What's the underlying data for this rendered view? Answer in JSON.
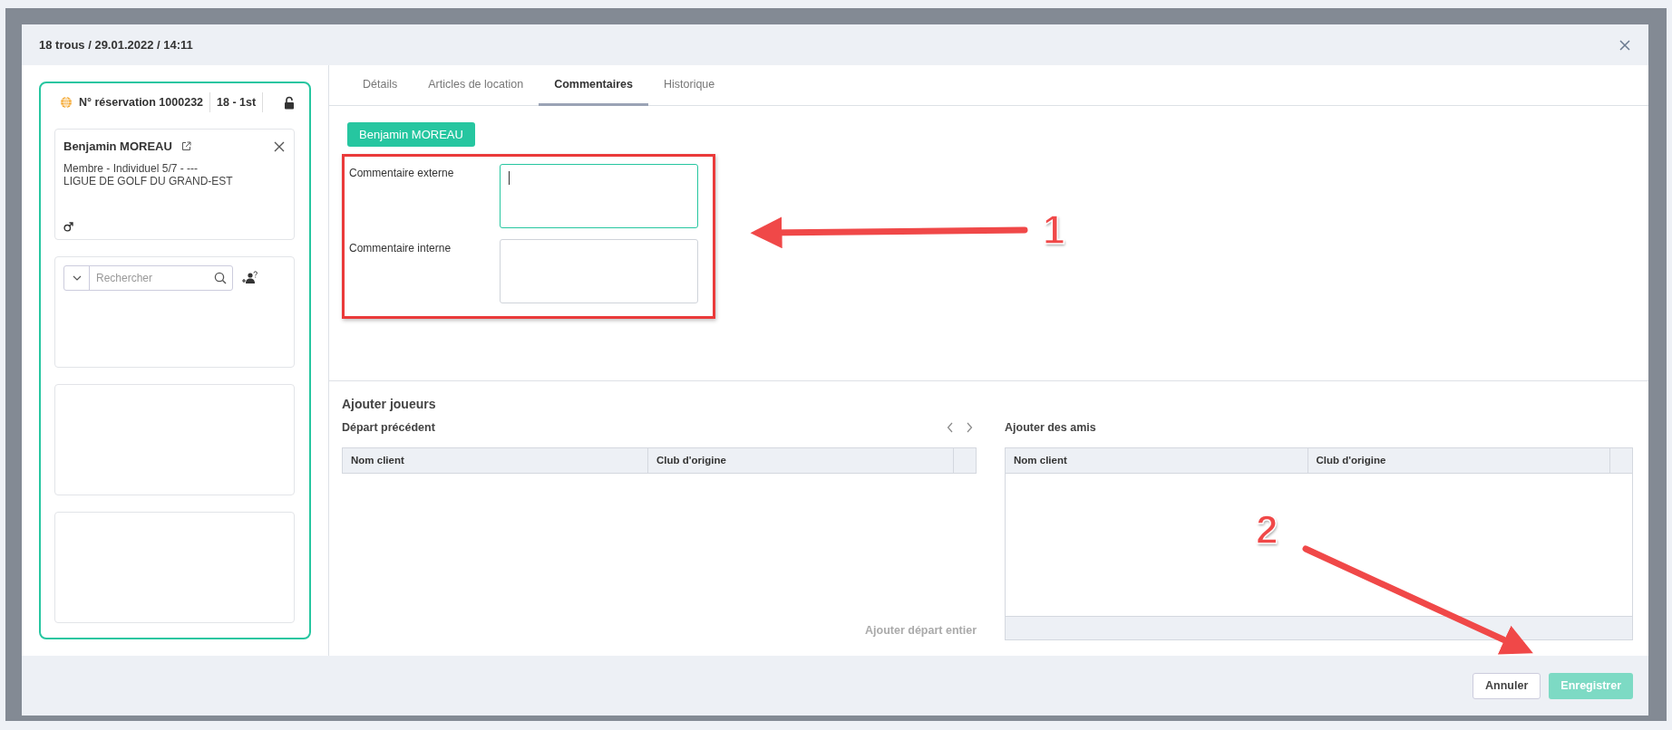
{
  "dialog": {
    "title": "18 trous / 29.01.2022 / 14:11"
  },
  "booking": {
    "reservation": "N° réservation 1000232",
    "tee": "18 - 1st",
    "locked": false
  },
  "player": {
    "name": "Benjamin MOREAU",
    "line_1": "Membre - Individuel 5/7 - ---",
    "line_2": "LIGUE DE GOLF DU GRAND-EST"
  },
  "search": {
    "placeholder": "Rechercher"
  },
  "tabs": [
    {
      "label": "Détails",
      "selected": false
    },
    {
      "label": "Articles de location",
      "selected": false
    },
    {
      "label": "Commentaires",
      "selected": true
    },
    {
      "label": "Historique",
      "selected": false
    }
  ],
  "player_button": "Benjamin MOREAU",
  "comments": [
    {
      "label": "Commentaire externe",
      "focused": true
    },
    {
      "label": "Commentaire interne",
      "focused": false
    }
  ],
  "add_players": {
    "title": "Ajouter joueurs",
    "previous": {
      "title": "Départ précédent",
      "columns": [
        "Nom client",
        "Club d'origine"
      ],
      "action": "Ajouter départ entier"
    },
    "friends": {
      "title": "Ajouter des amis",
      "columns": [
        "Nom client",
        "Club d'origine"
      ]
    }
  },
  "buttons": [
    {
      "label": "Annuler",
      "kind": "secondary",
      "disabled": false
    },
    {
      "label": "Enregistrer",
      "kind": "primary",
      "disabled": true
    }
  ],
  "annotations": [
    {
      "label": "1"
    },
    {
      "label": "2"
    }
  ]
}
